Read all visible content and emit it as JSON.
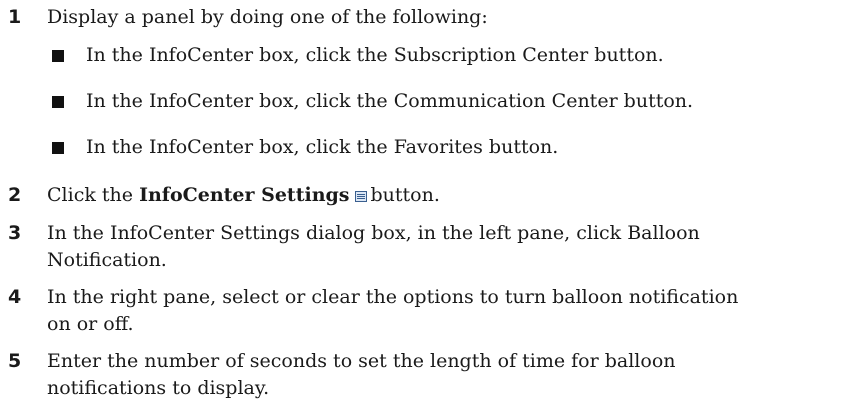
{
  "steps": [
    {
      "number": "1",
      "text": "Display a panel by doing one of the following:",
      "bullets": [
        "In the InfoCenter box, click the Subscription Center button.",
        "In the InfoCenter box, click the Communication Center button.",
        "In the InfoCenter box, click the Favorites button."
      ]
    },
    {
      "number": "2",
      "text_before": "Click the",
      "bold": "InfoCenter Settings",
      "icon": "infocenter-settings-icon",
      "text_after": "button."
    },
    {
      "number": "3",
      "lines": [
        "In the InfoCenter Settings dialog box, in the left pane, click Balloon",
        "Notification."
      ]
    },
    {
      "number": "4",
      "lines": [
        "In the right pane, select or clear the options to turn balloon notification",
        "on or off."
      ]
    },
    {
      "number": "5",
      "lines": [
        "Enter the number of seconds to set the length of time for balloon",
        "notifications to display."
      ]
    }
  ]
}
